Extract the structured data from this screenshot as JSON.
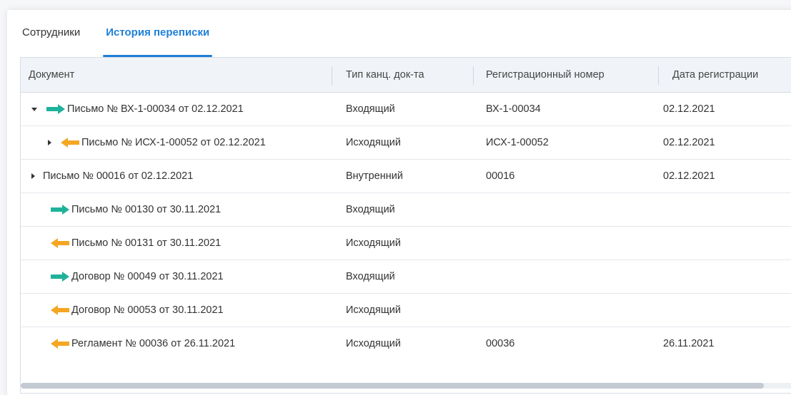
{
  "tabs": {
    "employees": "Сотрудники",
    "history": "История переписки"
  },
  "columns": {
    "document": "Документ",
    "type": "Тип канц. док-та",
    "reg_number": "Регистрационный номер",
    "reg_date": "Дата регистрации"
  },
  "colors": {
    "accent": "#1e7fd8",
    "incoming_arrow": "#1fb29a",
    "outgoing_arrow": "#f5a623"
  },
  "rows": [
    {
      "document": "Письмо № ВХ-1-00034 от 02.12.2021",
      "type": "Входящий",
      "reg_number": "ВХ-1-00034",
      "reg_date": "02.12.2021",
      "direction": "incoming",
      "expander": "expanded"
    },
    {
      "document": "Письмо № ИСХ-1-00052 от 02.12.2021",
      "type": "Исходящий",
      "reg_number": "ИСХ-1-00052",
      "reg_date": "02.12.2021",
      "direction": "outgoing",
      "expander": "collapsed"
    },
    {
      "document": "Письмо № 00016 от 02.12.2021",
      "type": "Внутренний",
      "reg_number": "00016",
      "reg_date": "02.12.2021",
      "direction": "none",
      "expander": "collapsed"
    },
    {
      "document": "Письмо № 00130 от 30.11.2021",
      "type": "Входящий",
      "reg_number": "",
      "reg_date": "",
      "direction": "incoming",
      "expander": "none"
    },
    {
      "document": "Письмо № 00131 от 30.11.2021",
      "type": "Исходящий",
      "reg_number": "",
      "reg_date": "",
      "direction": "outgoing",
      "expander": "none"
    },
    {
      "document": "Договор № 00049 от 30.11.2021",
      "type": "Входящий",
      "reg_number": "",
      "reg_date": "",
      "direction": "incoming",
      "expander": "none"
    },
    {
      "document": "Договор № 00053 от 30.11.2021",
      "type": "Исходящий",
      "reg_number": "",
      "reg_date": "",
      "direction": "outgoing",
      "expander": "none"
    },
    {
      "document": "Регламент № 00036 от 26.11.2021",
      "type": "Исходящий",
      "reg_number": "00036",
      "reg_date": "26.11.2021",
      "direction": "outgoing",
      "expander": "none"
    }
  ]
}
